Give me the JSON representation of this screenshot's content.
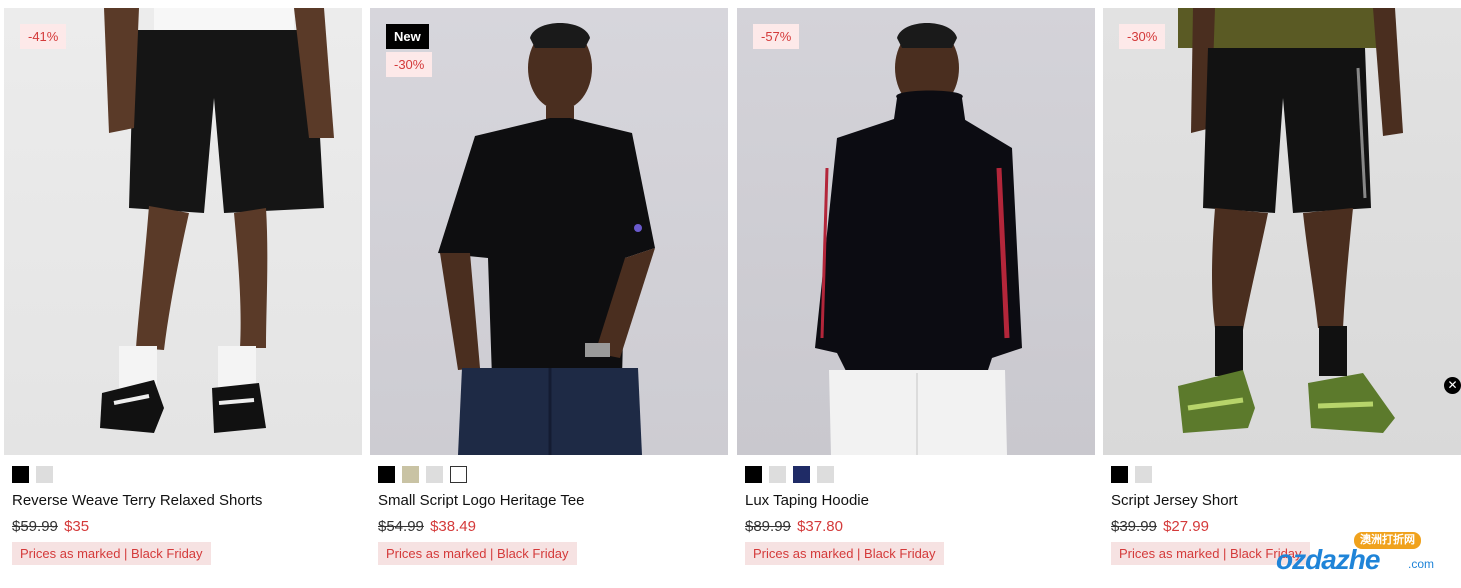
{
  "products": [
    {
      "name": "Reverse Weave Terry Relaxed Shorts",
      "badges": [
        "-41%"
      ],
      "swatches": [
        "#000000",
        "#dddddd"
      ],
      "old_price": "$59.99",
      "price": "$35",
      "promo": "Prices as marked | Black Friday"
    },
    {
      "name": "Small Script Logo Heritage Tee",
      "badges": [
        "New",
        "-30%"
      ],
      "swatches": [
        "#000000",
        "#c9c3a4",
        "#dddddd",
        "#ffffff"
      ],
      "old_price": "$54.99",
      "price": "$38.49",
      "promo": "Prices as marked | Black Friday"
    },
    {
      "name": "Lux Taping Hoodie",
      "badges": [
        "-57%"
      ],
      "swatches": [
        "#000000",
        "#dddddd",
        "#1f2b66",
        "#dddddd"
      ],
      "old_price": "$89.99",
      "price": "$37.80",
      "promo": "Prices as marked | Black Friday"
    },
    {
      "name": "Script Jersey Short",
      "badges": [
        "-30%"
      ],
      "swatches": [
        "#000000",
        "#dddddd"
      ],
      "old_price": "$39.99",
      "price": "$27.99",
      "promo": "Prices as marked | Black Friday"
    }
  ],
  "close_icon": "close-icon",
  "watermark": {
    "top": "澳洲打折网",
    "main": "ozdazhe",
    "suffix": ".com"
  },
  "colors": {
    "sale": "#d43a3a",
    "sale_bg": "#fde9e9",
    "promo_bg": "#f6e2e2"
  }
}
